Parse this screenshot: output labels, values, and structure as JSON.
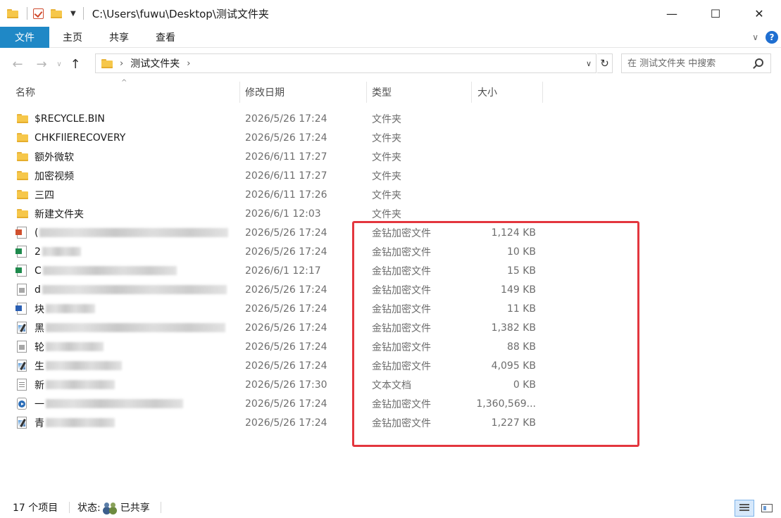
{
  "window": {
    "title": "C:\\Users\\fuwu\\Desktop\\测试文件夹",
    "minimize": "—",
    "maximize": "☐",
    "close": "✕"
  },
  "ribbon": {
    "tabs": [
      {
        "label": "文件"
      },
      {
        "label": "主页"
      },
      {
        "label": "共享"
      },
      {
        "label": "查看"
      }
    ],
    "help": "?"
  },
  "nav": {
    "back": "←",
    "forward": "→",
    "recent": "∨",
    "up": "↑",
    "breadcrumb": "测试文件夹",
    "refresh": "↻",
    "search_placeholder": "在 测试文件夹 中搜索"
  },
  "columns": {
    "name": "名称",
    "date": "修改日期",
    "type": "类型",
    "size": "大小"
  },
  "files": [
    {
      "icon": "folder-icon",
      "name": "$RECYCLE.BIN",
      "date": "2026/5/26 17:24",
      "type": "文件夹",
      "size": ""
    },
    {
      "icon": "folder-icon",
      "name": "CHKFIlERECOVERY",
      "date": "2026/5/26 17:24",
      "type": "文件夹",
      "size": ""
    },
    {
      "icon": "folder-icon",
      "name": "额外微软",
      "date": "2026/6/11 17:27",
      "type": "文件夹",
      "size": ""
    },
    {
      "icon": "folder-icon",
      "name": "加密视频",
      "date": "2026/6/11 17:27",
      "type": "文件夹",
      "size": ""
    },
    {
      "icon": "folder-icon",
      "name": "三四",
      "date": "2026/6/11 17:26",
      "type": "文件夹",
      "size": ""
    },
    {
      "icon": "folder-icon",
      "name": "新建文件夹",
      "date": "2026/6/1 12:03",
      "type": "文件夹",
      "size": ""
    },
    {
      "icon": "ppt-file-icon",
      "name": "(",
      "date": "2026/5/26 17:24",
      "type": "金钻加密文件",
      "size": "1,124 KB"
    },
    {
      "icon": "excel-file-icon",
      "name": "2",
      "date": "2026/5/26 17:24",
      "type": "金钻加密文件",
      "size": "10 KB"
    },
    {
      "icon": "excel-file-icon",
      "name": "C",
      "date": "2026/6/1 12:17",
      "type": "金钻加密文件",
      "size": "15 KB"
    },
    {
      "icon": "pdf-file-icon",
      "name": "d",
      "date": "2026/5/26 17:24",
      "type": "金钻加密文件",
      "size": "149 KB"
    },
    {
      "icon": "word-file-icon",
      "name": "块",
      "date": "2026/5/26 17:24",
      "type": "金钻加密文件",
      "size": "11 KB"
    },
    {
      "icon": "image-file-icon",
      "name": "黑",
      "date": "2026/5/26 17:24",
      "type": "金钻加密文件",
      "size": "1,382 KB"
    },
    {
      "icon": "pdf-file-icon",
      "name": "轮",
      "date": "2026/5/26 17:24",
      "type": "金钻加密文件",
      "size": "88 KB"
    },
    {
      "icon": "image-file-icon",
      "name": "生",
      "date": "2026/5/26 17:24",
      "type": "金钻加密文件",
      "size": "4,095 KB"
    },
    {
      "icon": "text-file-icon",
      "name": "新",
      "date": "2026/5/26 17:30",
      "type": "文本文档",
      "size": "0 KB"
    },
    {
      "icon": "video-file-icon",
      "name": "一",
      "date": "2026/5/26 17:24",
      "type": "金钻加密文件",
      "size": "1,360,569..."
    },
    {
      "icon": "image-file-icon",
      "name": "青",
      "date": "2026/5/26 17:24",
      "type": "金钻加密文件",
      "size": "1,227 KB"
    }
  ],
  "status": {
    "count": "17 个项目",
    "state_label": "状态:",
    "state_value": "已共享"
  }
}
